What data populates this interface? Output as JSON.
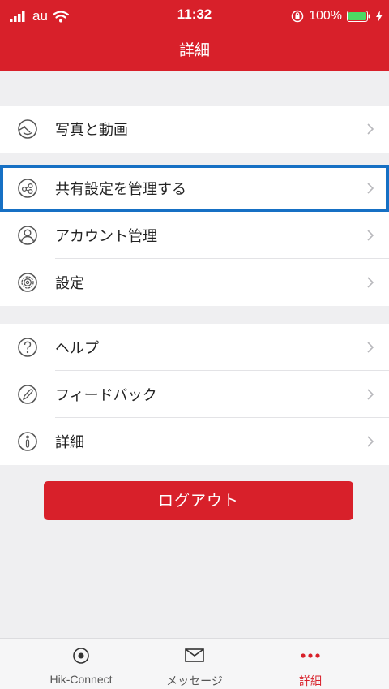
{
  "status_bar": {
    "carrier": "au",
    "time": "11:32",
    "battery": "100%"
  },
  "nav": {
    "title": "詳細"
  },
  "groups": [
    {
      "items": [
        {
          "label": "写真と動画",
          "icon": "smile-face-icon"
        }
      ]
    },
    {
      "items": [
        {
          "label": "共有設定を管理する",
          "icon": "share-icon",
          "highlighted": true
        },
        {
          "label": "アカウント管理",
          "icon": "account-icon"
        },
        {
          "label": "設定",
          "icon": "gear-icon"
        }
      ]
    },
    {
      "items": [
        {
          "label": "ヘルプ",
          "icon": "help-icon"
        },
        {
          "label": "フィードバック",
          "icon": "feedback-icon"
        },
        {
          "label": "詳細",
          "icon": "info-icon"
        }
      ]
    }
  ],
  "logout_label": "ログアウト",
  "tabs": [
    {
      "label": "Hik-Connect",
      "icon": "target-icon",
      "active": false
    },
    {
      "label": "メッセージ",
      "icon": "envelope-icon",
      "active": false
    },
    {
      "label": "詳細",
      "icon": "more-dots-icon",
      "active": true
    }
  ],
  "colors": {
    "brand_red": "#d8202a",
    "highlight_blue": "#1670c4",
    "background_gray": "#efeff1"
  }
}
